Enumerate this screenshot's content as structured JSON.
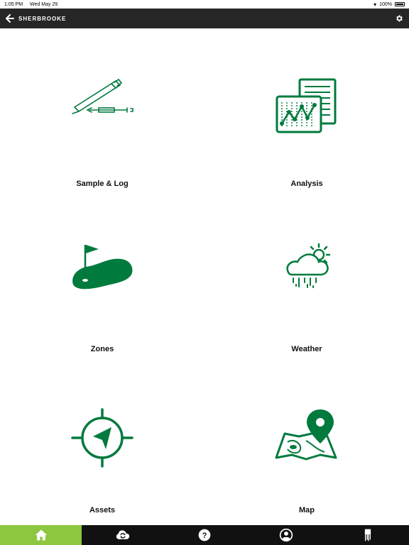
{
  "status": {
    "time": "1:05 PM",
    "date": "Wed May 29",
    "battery": "100%"
  },
  "header": {
    "title": "SHERBROOKE"
  },
  "tiles": [
    {
      "label": "Sample & Log",
      "icon": "pen-syringe-icon"
    },
    {
      "label": "Analysis",
      "icon": "report-chart-icon"
    },
    {
      "label": "Zones",
      "icon": "golf-green-flag-icon"
    },
    {
      "label": "Weather",
      "icon": "cloud-sun-rain-icon"
    },
    {
      "label": "Assets",
      "icon": "compass-crosshair-icon"
    },
    {
      "label": "Map",
      "icon": "map-pin-icon"
    }
  ],
  "tab_bar": {
    "items": [
      {
        "icon": "home-icon",
        "active": true
      },
      {
        "icon": "cloud-sync-icon",
        "active": false
      },
      {
        "icon": "help-icon",
        "active": false
      },
      {
        "icon": "user-icon",
        "active": false
      },
      {
        "icon": "soil-probe-icon",
        "active": false
      }
    ]
  },
  "colors": {
    "accent": "#007a3d",
    "active_tab": "#8dc63f",
    "header": "#262626",
    "tab_bar": "#111111"
  }
}
